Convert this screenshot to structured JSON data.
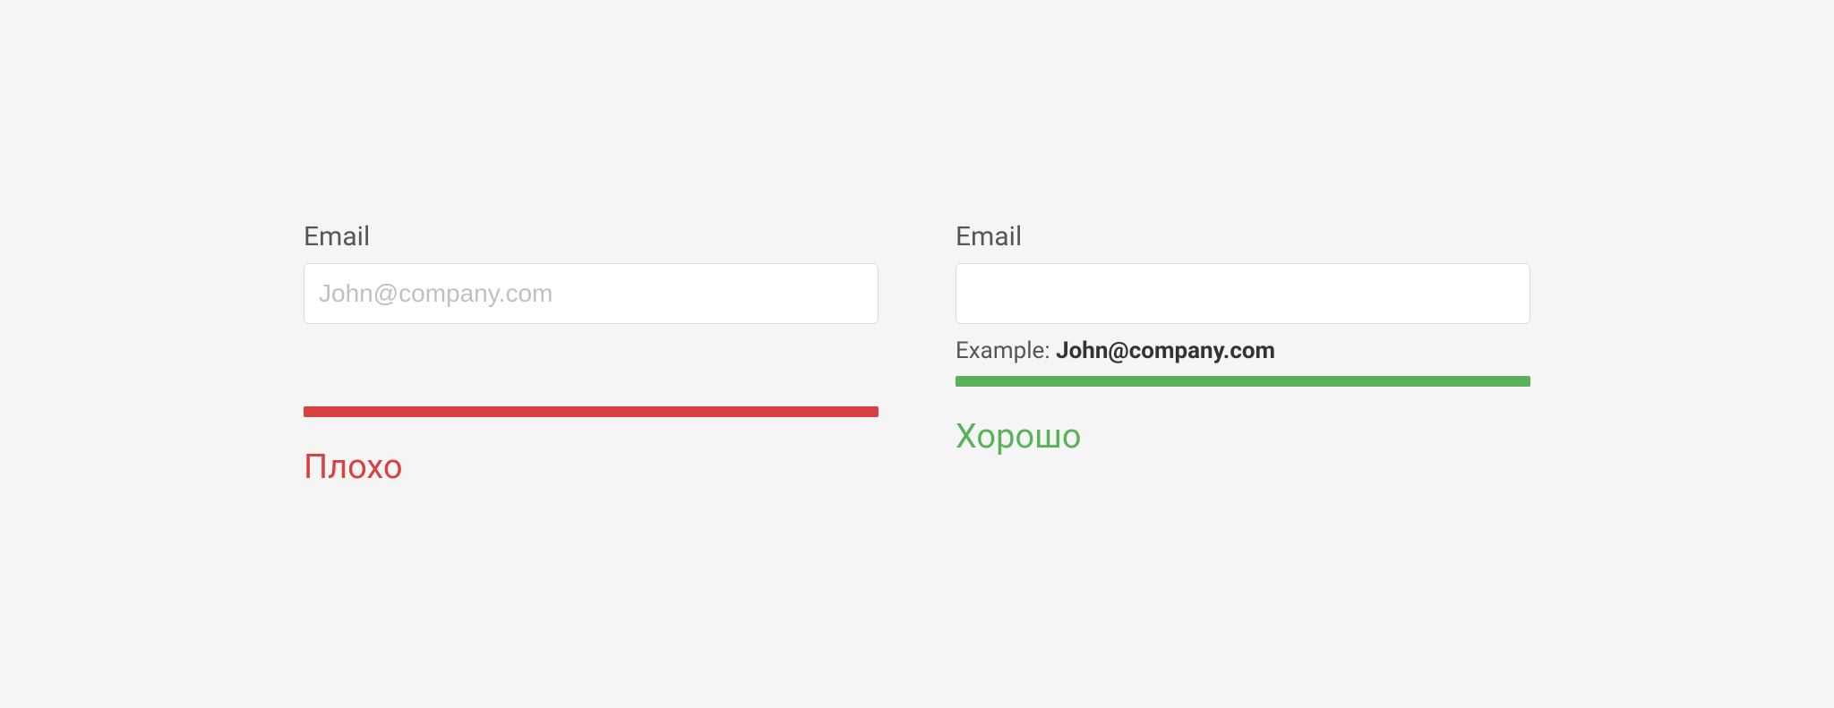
{
  "bad": {
    "label": "Email",
    "placeholder": "John@company.com",
    "verdict": "Плохо"
  },
  "good": {
    "label": "Email",
    "hint_prefix": "Example: ",
    "hint_value": "John@company.com",
    "verdict": "Хорошо"
  },
  "colors": {
    "bad": "#d94141",
    "good": "#5bb15b"
  }
}
